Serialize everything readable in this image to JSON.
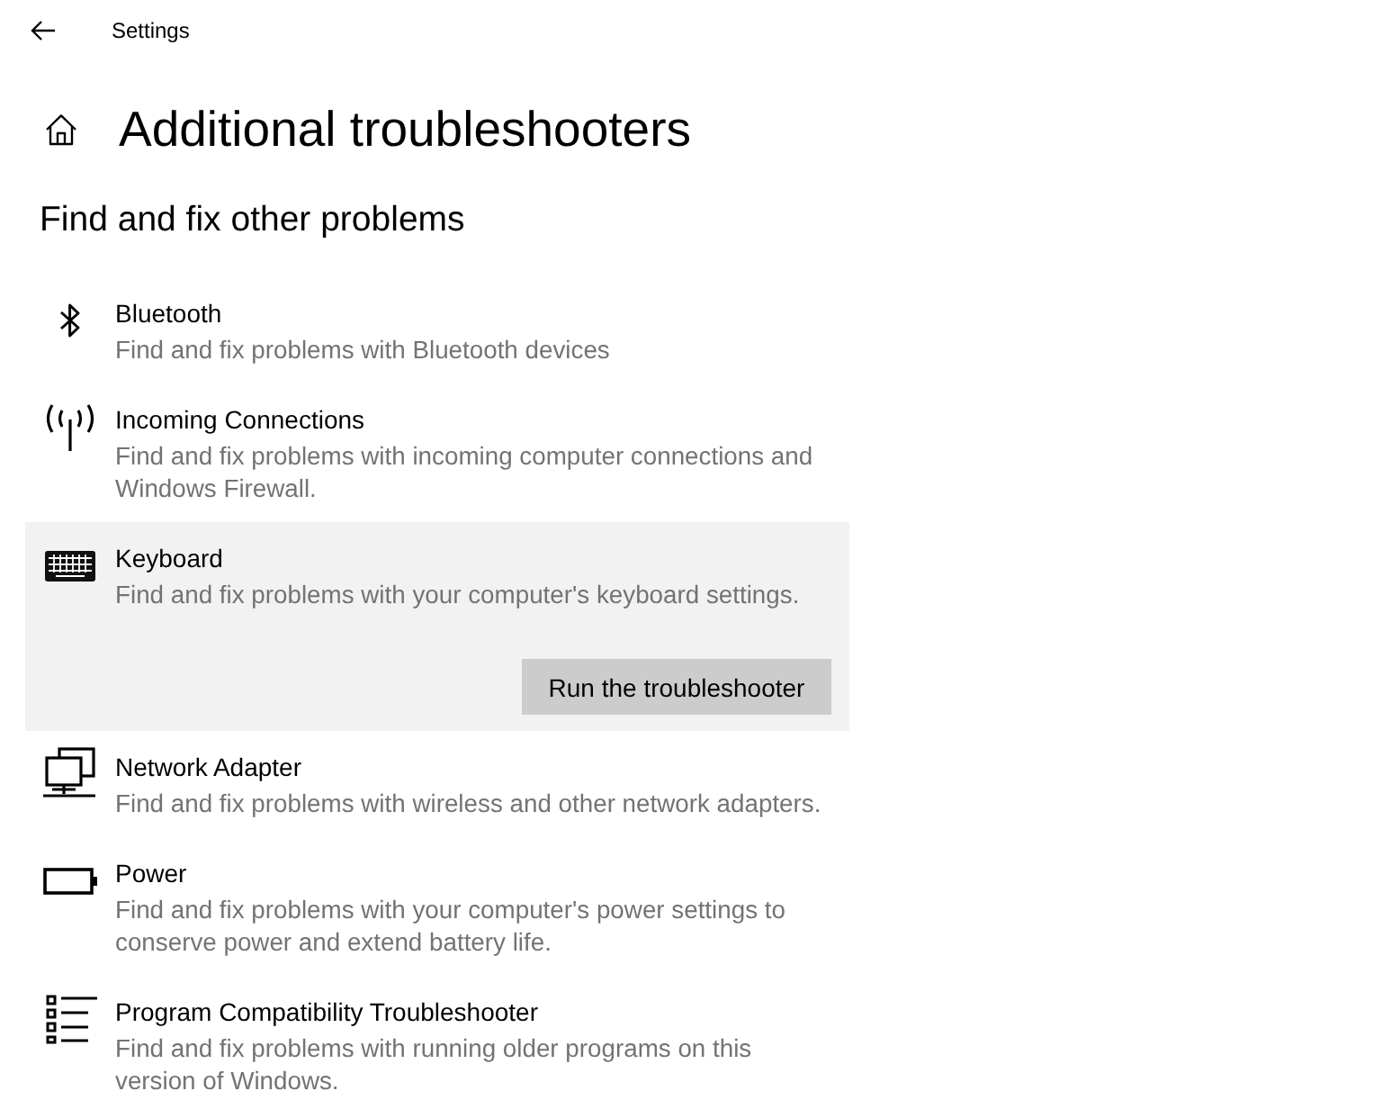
{
  "window": {
    "title": "Settings"
  },
  "page": {
    "title": "Additional troubleshooters"
  },
  "section": {
    "heading": "Find and fix other problems"
  },
  "troubleshooters": [
    {
      "kind": "bluetooth",
      "title": "Bluetooth",
      "description": "Find and fix problems with Bluetooth devices",
      "selected": false
    },
    {
      "kind": "incoming",
      "title": "Incoming Connections",
      "description": "Find and fix problems with incoming computer connections and Windows Firewall.",
      "selected": false
    },
    {
      "kind": "keyboard",
      "title": "Keyboard",
      "description": "Find and fix problems with your computer's keyboard settings.",
      "selected": true,
      "button": "Run the troubleshooter"
    },
    {
      "kind": "network",
      "title": "Network Adapter",
      "description": "Find and fix problems with wireless and other network adapters.",
      "selected": false
    },
    {
      "kind": "power",
      "title": "Power",
      "description": "Find and fix problems with your computer's power settings to conserve power and extend battery life.",
      "selected": false
    },
    {
      "kind": "program",
      "title": "Program Compatibility Troubleshooter",
      "description": "Find and fix problems with running older programs on this version of Windows.",
      "selected": false
    }
  ]
}
